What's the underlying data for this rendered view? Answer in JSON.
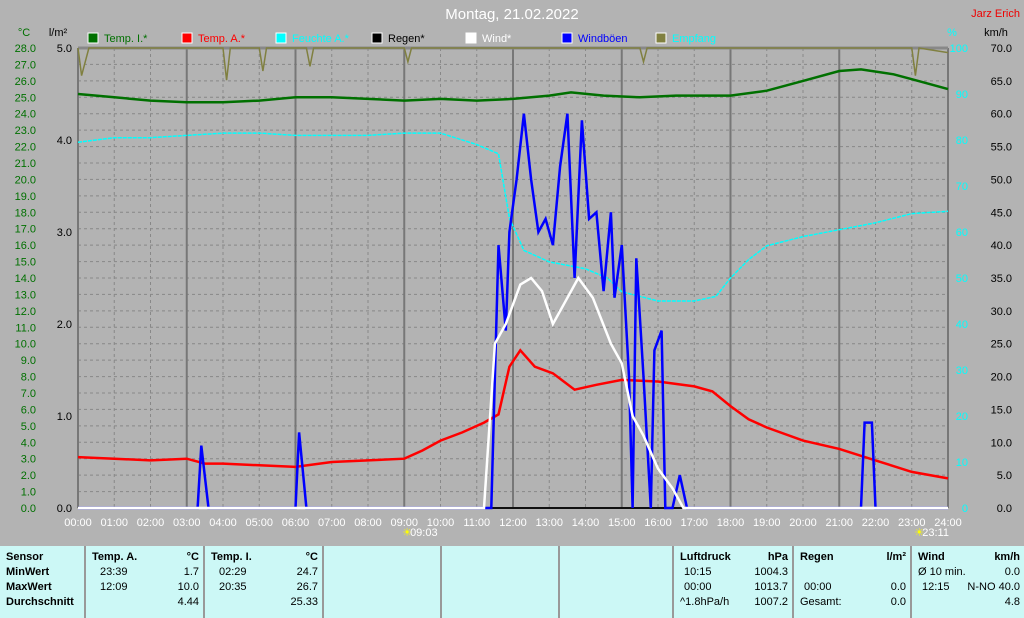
{
  "title": "Montag, 21.02.2022",
  "author": "Jarz Erich",
  "axis_units": {
    "temp": "°C",
    "rain": "l/m²",
    "humidity": "%",
    "wind": "km/h"
  },
  "legend": [
    {
      "label": "Temp. I.*",
      "color": "#007000"
    },
    {
      "label": "Temp. A.*",
      "color": "#ff0000"
    },
    {
      "label": "Feuchte A.*",
      "color": "#00ffff"
    },
    {
      "label": "Regen*",
      "color": "#000000"
    },
    {
      "label": "Wind*",
      "color": "#ffffff"
    },
    {
      "label": "Windböen",
      "color": "#0000ff"
    },
    {
      "label": "Empfang",
      "color": "#808040"
    }
  ],
  "markers": [
    {
      "label": "09:03",
      "hour": 9.05
    },
    {
      "label": "23:11",
      "hour": 23.18
    }
  ],
  "chart_data": {
    "type": "line",
    "title": "Montag, 21.02.2022",
    "xlim": [
      0,
      24
    ],
    "x_ticks": [
      "00:00",
      "01:00",
      "02:00",
      "03:00",
      "04:00",
      "05:00",
      "06:00",
      "07:00",
      "08:00",
      "09:00",
      "10:00",
      "11:00",
      "12:00",
      "13:00",
      "14:00",
      "15:00",
      "16:00",
      "17:00",
      "18:00",
      "19:00",
      "20:00",
      "21:00",
      "22:00",
      "23:00",
      "24:00"
    ],
    "axes": {
      "temp": {
        "range": [
          0,
          28
        ],
        "step": 1
      },
      "rain": {
        "range": [
          0,
          5
        ],
        "ticks": [
          "0.0",
          "1.0",
          "2.0",
          "3.0",
          "4.0",
          "5.0"
        ]
      },
      "humidity": {
        "range": [
          0,
          100
        ],
        "ticks": [
          "0",
          "10",
          "20",
          "30",
          "40",
          "50",
          "60",
          "70",
          "80",
          "90",
          "100"
        ]
      },
      "wind": {
        "range": [
          0,
          70
        ],
        "step": 5
      }
    },
    "series": [
      {
        "name": "Temp. I.*",
        "axis": "temp",
        "color": "#007000",
        "points": [
          [
            0,
            25.2
          ],
          [
            1,
            25.0
          ],
          [
            2,
            24.8
          ],
          [
            3,
            24.7
          ],
          [
            4,
            24.7
          ],
          [
            5,
            24.8
          ],
          [
            6,
            25.0
          ],
          [
            7,
            25.0
          ],
          [
            8,
            24.9
          ],
          [
            9,
            24.8
          ],
          [
            10,
            24.9
          ],
          [
            11,
            24.8
          ],
          [
            12,
            24.9
          ],
          [
            13,
            25.1
          ],
          [
            13.6,
            25.3
          ],
          [
            14.5,
            25.1
          ],
          [
            15.5,
            25.0
          ],
          [
            16.5,
            25.1
          ],
          [
            18,
            25.1
          ],
          [
            19,
            25.4
          ],
          [
            20,
            26.0
          ],
          [
            21,
            26.6
          ],
          [
            21.6,
            26.7
          ],
          [
            22.5,
            26.4
          ],
          [
            23,
            26.1
          ],
          [
            24,
            25.5
          ]
        ]
      },
      {
        "name": "Temp. A.*",
        "axis": "temp",
        "color": "#ff0000",
        "points": [
          [
            0,
            3.1
          ],
          [
            1,
            3.0
          ],
          [
            2,
            2.9
          ],
          [
            3,
            3.0
          ],
          [
            3.5,
            2.7
          ],
          [
            4,
            2.7
          ],
          [
            5,
            2.6
          ],
          [
            6,
            2.5
          ],
          [
            7,
            2.8
          ],
          [
            8,
            2.9
          ],
          [
            9,
            3.0
          ],
          [
            9.5,
            3.5
          ],
          [
            10,
            4.1
          ],
          [
            10.6,
            4.6
          ],
          [
            11.2,
            5.2
          ],
          [
            11.6,
            5.7
          ],
          [
            11.9,
            8.6
          ],
          [
            12.2,
            9.6
          ],
          [
            12.6,
            8.6
          ],
          [
            13.1,
            8.2
          ],
          [
            13.7,
            7.2
          ],
          [
            14.3,
            7.5
          ],
          [
            15,
            7.8
          ],
          [
            16,
            7.7
          ],
          [
            17,
            7.4
          ],
          [
            17.5,
            7.1
          ],
          [
            18,
            6.2
          ],
          [
            18.5,
            5.4
          ],
          [
            19,
            4.9
          ],
          [
            20,
            4.1
          ],
          [
            21,
            3.6
          ],
          [
            22,
            2.9
          ],
          [
            23,
            2.2
          ],
          [
            24,
            1.8
          ]
        ]
      },
      {
        "name": "Feuchte A.*",
        "axis": "humidity",
        "color": "#00ffff",
        "points": [
          [
            0,
            79.5
          ],
          [
            1,
            80.5
          ],
          [
            2,
            80.5
          ],
          [
            3,
            81
          ],
          [
            4,
            81.5
          ],
          [
            5,
            81.5
          ],
          [
            6,
            81
          ],
          [
            8,
            81
          ],
          [
            9,
            81.5
          ],
          [
            10,
            81.5
          ],
          [
            11,
            79
          ],
          [
            11.6,
            77
          ],
          [
            11.9,
            63
          ],
          [
            12.3,
            56
          ],
          [
            13,
            53.5
          ],
          [
            14,
            52
          ],
          [
            14.6,
            50
          ],
          [
            15,
            47
          ],
          [
            16,
            45
          ],
          [
            17,
            45
          ],
          [
            17.6,
            46
          ],
          [
            18,
            50
          ],
          [
            18.5,
            54
          ],
          [
            19,
            57
          ],
          [
            20,
            59
          ],
          [
            21,
            60.5
          ],
          [
            22,
            62
          ],
          [
            23,
            64
          ],
          [
            24,
            64.5
          ]
        ]
      },
      {
        "name": "Regen*",
        "axis": "rain",
        "color": "#000000",
        "points": [
          [
            0,
            0
          ],
          [
            24,
            0
          ]
        ]
      },
      {
        "name": "Wind*",
        "axis": "wind",
        "color": "#ffffff",
        "points": [
          [
            0,
            0
          ],
          [
            11.2,
            0
          ],
          [
            11.5,
            25
          ],
          [
            11.8,
            28
          ],
          [
            12.2,
            34
          ],
          [
            12.5,
            35
          ],
          [
            12.8,
            33
          ],
          [
            13.1,
            28
          ],
          [
            13.4,
            31
          ],
          [
            13.8,
            35
          ],
          [
            14.2,
            32
          ],
          [
            14.7,
            25
          ],
          [
            15,
            22
          ],
          [
            15.3,
            14
          ],
          [
            15.6,
            11
          ],
          [
            16,
            6
          ],
          [
            16.4,
            3
          ],
          [
            16.7,
            0
          ],
          [
            24,
            0
          ]
        ]
      },
      {
        "name": "Windböen",
        "axis": "wind",
        "color": "#0000ff",
        "points": [
          [
            0,
            0
          ],
          [
            3.3,
            0
          ],
          [
            3.4,
            9.5
          ],
          [
            3.6,
            0
          ],
          [
            6,
            0
          ],
          [
            6.1,
            11.5
          ],
          [
            6.3,
            0
          ],
          [
            11.4,
            0
          ],
          [
            11.6,
            40
          ],
          [
            11.8,
            27
          ],
          [
            11.9,
            42
          ],
          [
            12.1,
            50
          ],
          [
            12.3,
            60
          ],
          [
            12.5,
            50
          ],
          [
            12.7,
            42
          ],
          [
            12.9,
            44
          ],
          [
            13.1,
            40
          ],
          [
            13.3,
            52
          ],
          [
            13.5,
            60
          ],
          [
            13.7,
            35
          ],
          [
            13.9,
            59
          ],
          [
            14.1,
            44
          ],
          [
            14.3,
            45
          ],
          [
            14.5,
            33
          ],
          [
            14.7,
            45
          ],
          [
            14.8,
            32
          ],
          [
            15.0,
            40
          ],
          [
            15.2,
            20
          ],
          [
            15.3,
            0
          ],
          [
            15.4,
            38
          ],
          [
            15.6,
            20
          ],
          [
            15.8,
            0
          ],
          [
            15.9,
            24
          ],
          [
            16.1,
            27
          ],
          [
            16.2,
            0
          ],
          [
            16.4,
            0
          ],
          [
            16.6,
            5
          ],
          [
            16.8,
            0
          ],
          [
            21.6,
            0
          ],
          [
            21.7,
            13
          ],
          [
            21.9,
            13
          ],
          [
            22,
            0
          ],
          [
            24,
            0
          ]
        ]
      },
      {
        "name": "Empfang",
        "axis": "humidity",
        "color": "#808040",
        "points": [
          [
            0,
            100
          ],
          [
            0.1,
            94
          ],
          [
            0.3,
            100
          ],
          [
            4,
            100
          ],
          [
            4.1,
            93
          ],
          [
            4.2,
            100
          ],
          [
            5,
            100
          ],
          [
            5.1,
            95
          ],
          [
            5.2,
            100
          ],
          [
            6.3,
            100
          ],
          [
            6.4,
            96
          ],
          [
            6.5,
            100
          ],
          [
            9,
            100
          ],
          [
            9.1,
            97
          ],
          [
            9.2,
            100
          ],
          [
            15.5,
            100
          ],
          [
            15.6,
            97
          ],
          [
            15.7,
            100
          ],
          [
            23,
            100
          ],
          [
            23.1,
            94
          ],
          [
            23.2,
            100
          ],
          [
            24,
            99
          ]
        ]
      }
    ]
  },
  "table": {
    "temp_a": {
      "header": "Temp. A.",
      "unit": "°C",
      "min_time": "23:39",
      "min": "1.7",
      "max_time": "12:09",
      "max": "10.0",
      "avg": "4.44"
    },
    "temp_i": {
      "header": "Temp. I.",
      "unit": "°C",
      "min_time": "02:29",
      "min": "24.7",
      "max_time": "20:35",
      "max": "26.7",
      "avg": "25.33"
    },
    "labels": {
      "sensor": "Sensor",
      "min": "MinWert",
      "max": "MaxWert",
      "avg": "Durchschnitt"
    },
    "pressure": {
      "header": "Luftdruck",
      "unit": "hPa",
      "r1a": "10:15",
      "r1b": "1004.3",
      "r2a": "00:00",
      "r2b": "1013.7",
      "r3a": "^1.8hPa/h",
      "r3b": "1007.2"
    },
    "rain": {
      "header": "Regen",
      "unit": "l/m²",
      "r2a": "00:00",
      "r2b": "0.0",
      "r3a": "Gesamt:",
      "r3b": "0.0"
    },
    "wind": {
      "header": "Wind",
      "unit": "km/h",
      "r1a": "Ø 10 min.",
      "r1b": "0.0",
      "r2a": "12:15",
      "r2b": "N-NO 40.0",
      "r3b": "4.8"
    }
  }
}
